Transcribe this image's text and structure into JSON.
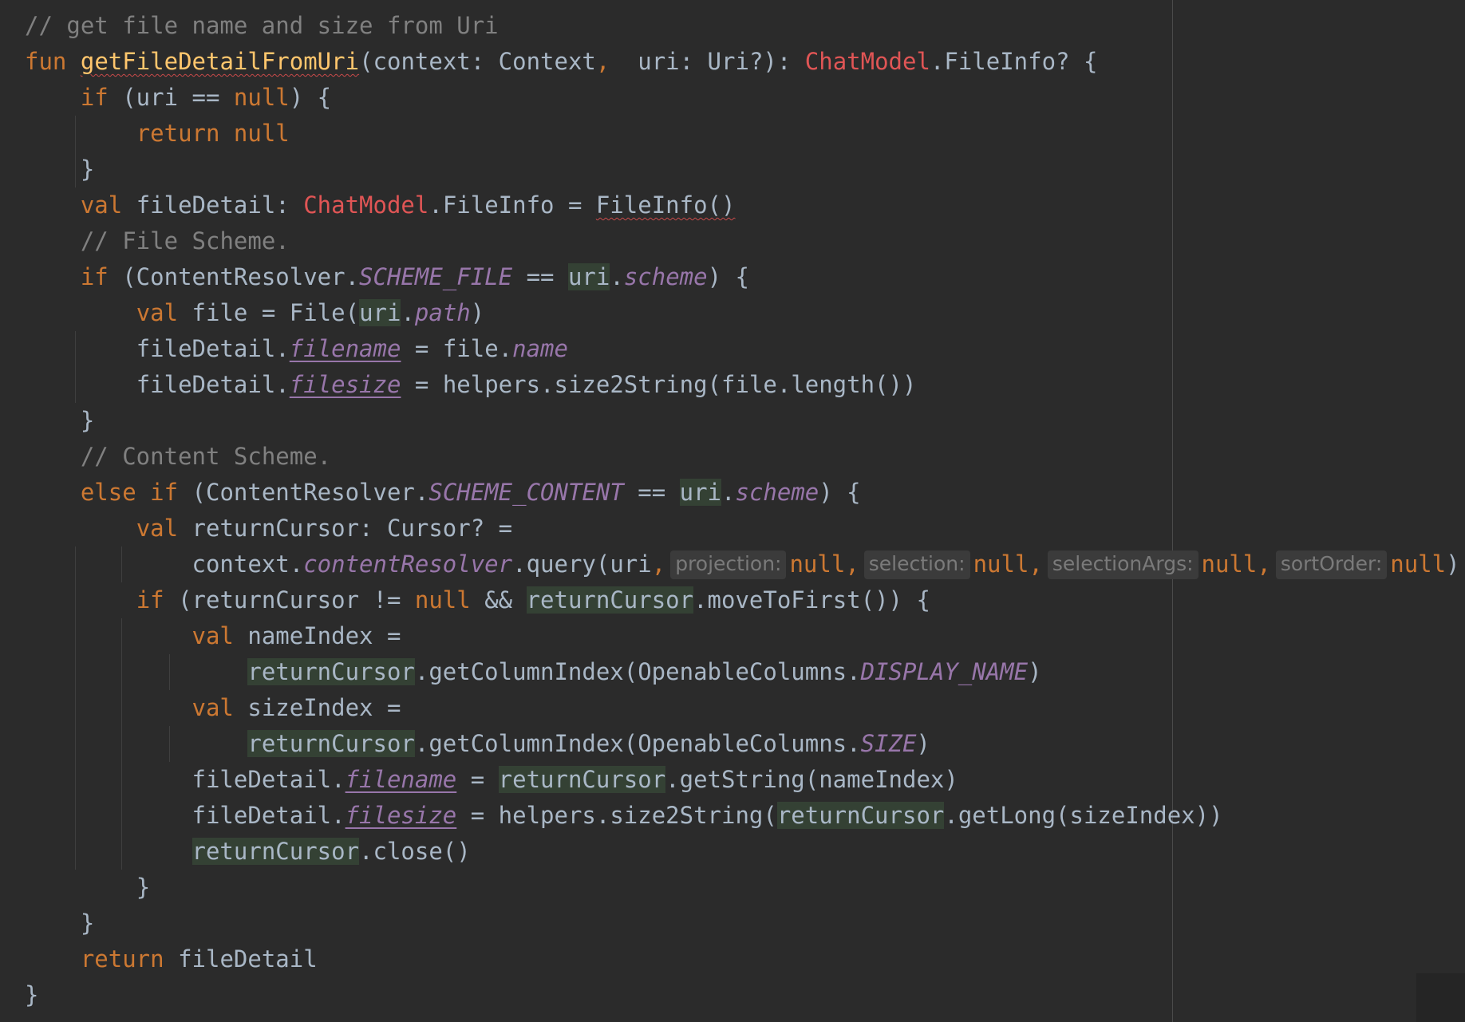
{
  "editor": {
    "colors": {
      "background": "#2b2b2b",
      "keyword": "#cc7832",
      "comment": "#808080",
      "function_decl": "#ffc66d",
      "error_class": "#e05555",
      "property": "#9876aa",
      "default_text": "#a9b7c6",
      "smart_cast_highlight": "#344134",
      "inlay_hint_bg": "#3b3b3b"
    },
    "code": {
      "l1": {
        "comment": "// get file name and size from Uri"
      },
      "l2": {
        "kw_fun": "fun",
        "fn_name": "getFileDetailFromUri",
        "t1": "(context: Context",
        "comma": ",",
        "t2": "  uri: Uri?): ",
        "cls": "ChatModel",
        "t3": ".FileInfo? {"
      },
      "l3": {
        "kw_if": "if",
        "t1": " (uri == ",
        "kw_null": "null",
        "t2": ") {"
      },
      "l4": {
        "kw_return": "return",
        "kw_null": "null"
      },
      "l5": {
        "brace": "}"
      },
      "l6": {
        "kw_val": "val",
        "t1": " fileDetail: ",
        "cls": "ChatModel",
        "t2": ".FileInfo = ",
        "err_ref": "FileInfo()"
      },
      "l7": {
        "comment": "// File Scheme."
      },
      "l8": {
        "kw_if": "if",
        "t1": " (ContentResolver.",
        "const": "SCHEME_FILE",
        "t2": " == ",
        "smart": "uri",
        "dot": ".",
        "prop": "scheme",
        "t3": ") {"
      },
      "l9": {
        "kw_val": "val",
        "t1": " file = File(",
        "smart": "uri",
        "dot": ".",
        "prop": "path",
        "t2": ")"
      },
      "l10": {
        "t1": "fileDetail.",
        "prop": "filename",
        "t2": " = file.",
        "prop2": "name"
      },
      "l11": {
        "t1": "fileDetail.",
        "prop": "filesize",
        "t2": " = helpers.size2String(file.length())"
      },
      "l12": {
        "brace": "}"
      },
      "l13": {
        "comment": "// Content Scheme."
      },
      "l14": {
        "kw_else": "else",
        "kw_if": "if",
        "t1": " (ContentResolver.",
        "const": "SCHEME_CONTENT",
        "t2": " == ",
        "smart": "uri",
        "dot": ".",
        "prop": "scheme",
        "t3": ") {"
      },
      "l15": {
        "kw_val": "val",
        "t1": " returnCursor: Cursor? ="
      },
      "l16": {
        "t1": "context.",
        "prop": "contentResolver",
        "t2": ".query(uri",
        "comma": ",",
        "hint1": "projection:",
        "null1": "null",
        "comma1": ",",
        "hint2": "selection:",
        "null2": "null",
        "comma2": ",",
        "hint3": "selectionArgs:",
        "null3": "null",
        "comma3": ",",
        "hint4": "sortOrder:",
        "null4": "null",
        "t3": ")"
      },
      "l17": {
        "kw_if": "if",
        "t1": " (returnCursor != ",
        "kw_null": "null",
        "t2": " && ",
        "smart": "returnCursor",
        "t3": ".moveToFirst()) {"
      },
      "l18": {
        "kw_val": "val",
        "t1": " nameIndex ="
      },
      "l19": {
        "smart": "returnCursor",
        "t1": ".getColumnIndex(OpenableColumns.",
        "const": "DISPLAY_NAME",
        "t2": ")"
      },
      "l20": {
        "kw_val": "val",
        "t1": " sizeIndex ="
      },
      "l21": {
        "smart": "returnCursor",
        "t1": ".getColumnIndex(OpenableColumns.",
        "const": "SIZE",
        "t2": ")"
      },
      "l22": {
        "t1": "fileDetail.",
        "prop": "filename",
        "t2": " = ",
        "smart": "returnCursor",
        "t3": ".getString(nameIndex)"
      },
      "l23": {
        "t1": "fileDetail.",
        "prop": "filesize",
        "t2": " = helpers.size2String(",
        "smart": "returnCursor",
        "t3": ".getLong(sizeIndex))"
      },
      "l24": {
        "smart": "returnCursor",
        "t1": ".close()"
      },
      "l25": {
        "brace": "}"
      },
      "l26": {
        "brace": "}"
      },
      "l27": {
        "kw_return": "return",
        "t1": " fileDetail"
      },
      "l28": {
        "brace": "}"
      }
    }
  }
}
